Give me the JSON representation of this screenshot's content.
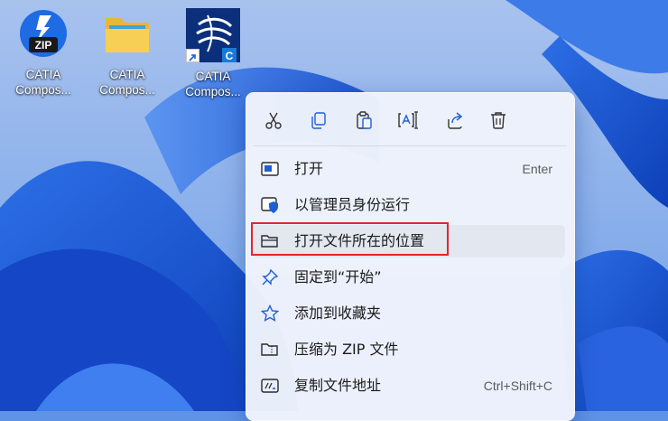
{
  "desktop": {
    "icons": [
      {
        "label_line1": "CATIA",
        "label_line2": "Compos...",
        "icon": "zip-app-icon"
      },
      {
        "label_line1": "CATIA",
        "label_line2": "Compos...",
        "icon": "folder-icon"
      },
      {
        "label_line1": "CATIA",
        "label_line2": "Compos...",
        "icon": "catia-composer-shortcut-icon"
      }
    ],
    "zip_badge": "ZIP",
    "catia_badge": "C"
  },
  "context_menu": {
    "quick_actions": [
      {
        "name": "cut",
        "icon": "scissors-icon"
      },
      {
        "name": "copy",
        "icon": "copy-icon"
      },
      {
        "name": "paste",
        "icon": "paste-icon"
      },
      {
        "name": "rename",
        "icon": "rename-icon"
      },
      {
        "name": "share",
        "icon": "share-icon"
      },
      {
        "name": "delete",
        "icon": "trash-icon"
      }
    ],
    "items": [
      {
        "label": "打开",
        "shortcut": "Enter",
        "icon": "open-window-icon"
      },
      {
        "label": "以管理员身份运行",
        "shortcut": "",
        "icon": "shield-icon"
      },
      {
        "label": "打开文件所在的位置",
        "shortcut": "",
        "icon": "folder-outline-icon",
        "highlighted": true
      },
      {
        "label": "固定到“开始”",
        "shortcut": "",
        "icon": "pin-icon"
      },
      {
        "label": "添加到收藏夹",
        "shortcut": "",
        "icon": "star-icon"
      },
      {
        "label": "压缩为 ZIP 文件",
        "shortcut": "",
        "icon": "zip-folder-icon"
      },
      {
        "label": "复制文件地址",
        "shortcut": "Ctrl+Shift+C",
        "icon": "copy-path-icon"
      }
    ]
  },
  "colors": {
    "highlight_border": "#e3262d",
    "wallpaper_blue": "#1f5fd6",
    "menu_bg": "#eff3fc"
  }
}
